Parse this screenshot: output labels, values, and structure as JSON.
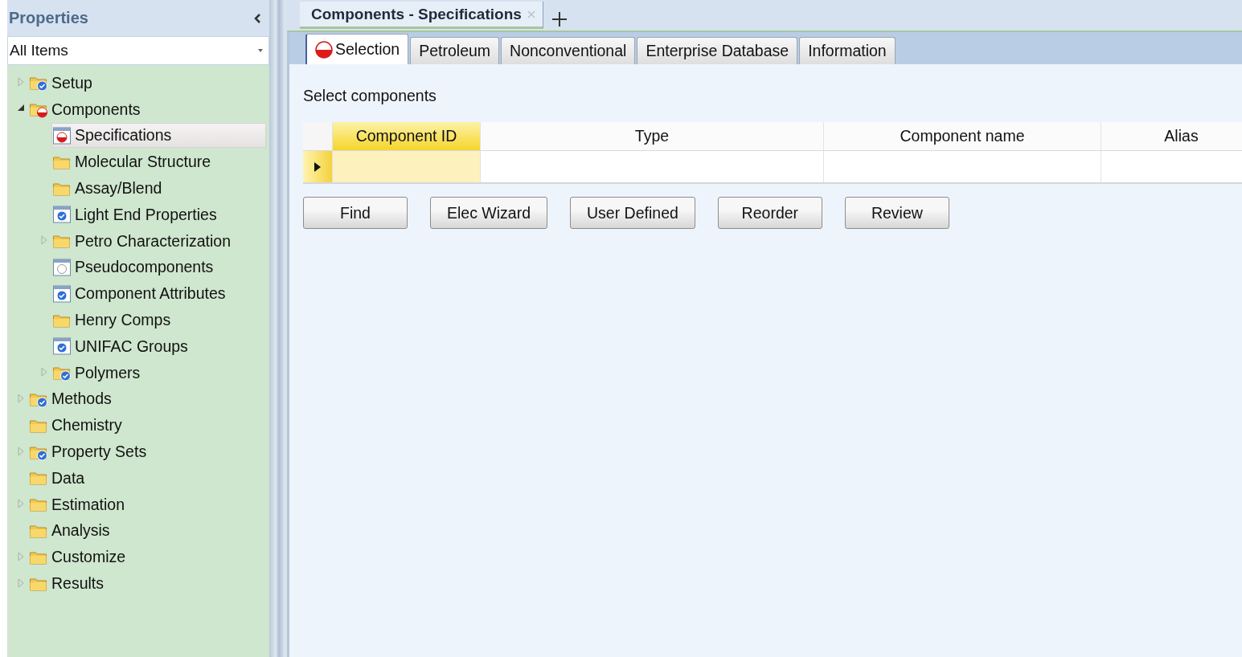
{
  "sidebar": {
    "title": "Properties",
    "filter": {
      "value": "All Items"
    },
    "tree": [
      {
        "label": "Setup",
        "kind": "folder-check",
        "expanded": false,
        "selected": false
      },
      {
        "label": "Components",
        "kind": "folder-error",
        "expanded": true,
        "selected": false,
        "children": [
          {
            "label": "Specifications",
            "kind": "form-error",
            "selected": true
          },
          {
            "label": "Molecular Structure",
            "kind": "folder",
            "selected": false
          },
          {
            "label": "Assay/Blend",
            "kind": "folder",
            "selected": false
          },
          {
            "label": "Light End Properties",
            "kind": "form-check",
            "selected": false
          },
          {
            "label": "Petro Characterization",
            "kind": "folder",
            "expanded": false,
            "selected": false
          },
          {
            "label": "Pseudocomponents",
            "kind": "form-empty",
            "selected": false
          },
          {
            "label": "Component Attributes",
            "kind": "form-check",
            "selected": false
          },
          {
            "label": "Henry Comps",
            "kind": "folder",
            "selected": false
          },
          {
            "label": "UNIFAC Groups",
            "kind": "form-check",
            "selected": false
          },
          {
            "label": "Polymers",
            "kind": "folder-check",
            "expanded": false,
            "selected": false
          }
        ]
      },
      {
        "label": "Methods",
        "kind": "folder-check",
        "expanded": false,
        "selected": false
      },
      {
        "label": "Chemistry",
        "kind": "folder",
        "selected": false
      },
      {
        "label": "Property Sets",
        "kind": "folder-check",
        "expanded": false,
        "selected": false
      },
      {
        "label": "Data",
        "kind": "folder",
        "selected": false
      },
      {
        "label": "Estimation",
        "kind": "folder",
        "expanded": false,
        "selected": false
      },
      {
        "label": "Analysis",
        "kind": "folder",
        "selected": false
      },
      {
        "label": "Customize",
        "kind": "folder",
        "expanded": false,
        "selected": false
      },
      {
        "label": "Results",
        "kind": "folder",
        "expanded": false,
        "selected": false
      }
    ]
  },
  "document_tabs": [
    {
      "label": "Components - Specifications",
      "selected": true
    }
  ],
  "tabs": [
    {
      "label": "Selection",
      "kind": "error",
      "selected": true
    },
    {
      "label": "Petroleum",
      "kind": "plain",
      "selected": false
    },
    {
      "label": "Nonconventional",
      "kind": "plain",
      "selected": false
    },
    {
      "label": "Enterprise Database",
      "kind": "plain",
      "selected": false
    },
    {
      "label": "Information",
      "kind": "plain",
      "selected": false
    }
  ],
  "section_label": "Select components",
  "grid": {
    "columns": [
      {
        "label": "Component ID",
        "current": true
      },
      {
        "label": "Type",
        "current": false
      },
      {
        "label": "Component name",
        "current": false
      },
      {
        "label": "Alias",
        "current": false
      }
    ],
    "rows": [
      {
        "current": true
      }
    ]
  },
  "buttons": [
    "Find",
    "Elec Wizard",
    "User Defined",
    "Reorder",
    "Review"
  ]
}
